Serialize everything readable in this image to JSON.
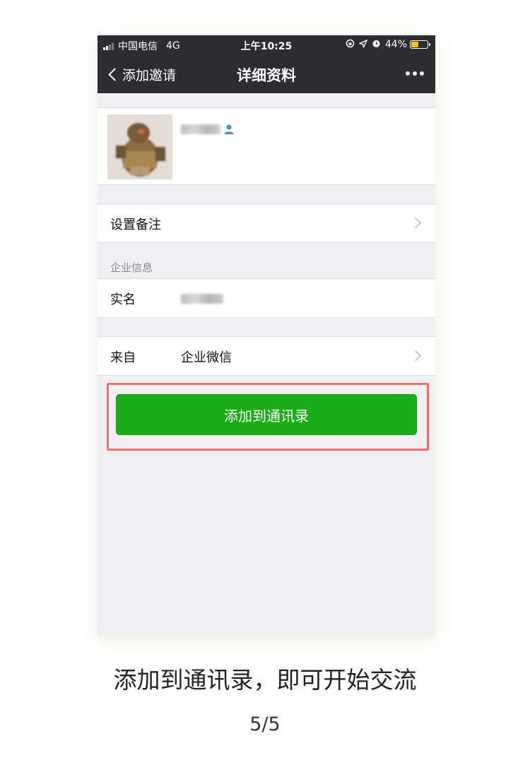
{
  "status_bar": {
    "carrier": "中国电信",
    "network": "4G",
    "time": "上午10:25",
    "battery": "44%",
    "battery_level": 0.44,
    "battery_color": "#f5c518",
    "icons": [
      "signal-icon",
      "rotation-lock-icon",
      "location-icon",
      "alarm-icon",
      "battery-icon"
    ]
  },
  "nav": {
    "back_label": "添加邀请",
    "title": "详细资料",
    "more_icon": "more-icon"
  },
  "profile": {
    "name_blurred": true,
    "contact_icon": "contact-person-icon"
  },
  "rows": {
    "remark_label": "设置备注",
    "section_header": "企业信息",
    "realname_label": "实名",
    "from_label": "来自",
    "from_value": "企业微信"
  },
  "actions": {
    "add_button_label": "添加到通讯录",
    "add_button_color": "#1aad19",
    "highlight_color": "#f06e6e"
  },
  "caption": "添加到通讯录，即可开始交流",
  "page_indicator": "5/5"
}
